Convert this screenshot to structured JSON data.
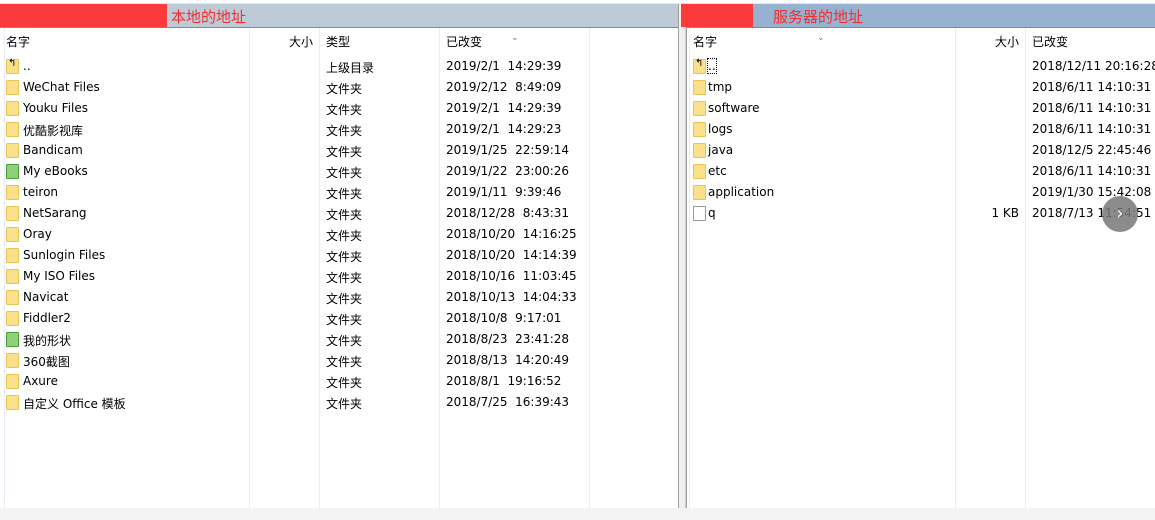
{
  "local": {
    "title": "本地的地址",
    "headers": {
      "name": "名字",
      "size": "大小",
      "type": "类型",
      "modified": "已改变"
    },
    "rows": [
      {
        "name": "..",
        "type": "上级目录",
        "modified": "2019/2/1  14:29:39",
        "icon": "parent-folder"
      },
      {
        "name": "WeChat Files",
        "type": "文件夹",
        "modified": "2019/2/12  8:49:09",
        "icon": "folder"
      },
      {
        "name": "Youku Files",
        "type": "文件夹",
        "modified": "2019/2/1  14:29:39",
        "icon": "folder"
      },
      {
        "name": "优酷影视库",
        "type": "文件夹",
        "modified": "2019/2/1  14:29:23",
        "icon": "folder"
      },
      {
        "name": "Bandicam",
        "type": "文件夹",
        "modified": "2019/1/25  22:59:14",
        "icon": "folder"
      },
      {
        "name": "My eBooks",
        "type": "文件夹",
        "modified": "2019/1/22  23:00:26",
        "icon": "special-folder"
      },
      {
        "name": "teiron",
        "type": "文件夹",
        "modified": "2019/1/11  9:39:46",
        "icon": "folder"
      },
      {
        "name": "NetSarang",
        "type": "文件夹",
        "modified": "2018/12/28  8:43:31",
        "icon": "folder"
      },
      {
        "name": "Oray",
        "type": "文件夹",
        "modified": "2018/10/20  14:16:25",
        "icon": "folder"
      },
      {
        "name": "Sunlogin Files",
        "type": "文件夹",
        "modified": "2018/10/20  14:14:39",
        "icon": "folder"
      },
      {
        "name": "My ISO Files",
        "type": "文件夹",
        "modified": "2018/10/16  11:03:45",
        "icon": "folder"
      },
      {
        "name": "Navicat",
        "type": "文件夹",
        "modified": "2018/10/13  14:04:33",
        "icon": "folder"
      },
      {
        "name": "Fiddler2",
        "type": "文件夹",
        "modified": "2018/10/8  9:17:01",
        "icon": "folder"
      },
      {
        "name": "我的形状",
        "type": "文件夹",
        "modified": "2018/8/23  23:41:28",
        "icon": "special-folder"
      },
      {
        "name": "360截图",
        "type": "文件夹",
        "modified": "2018/8/13  14:20:49",
        "icon": "folder"
      },
      {
        "name": "Axure",
        "type": "文件夹",
        "modified": "2018/8/1  19:16:52",
        "icon": "folder"
      },
      {
        "name": "自定义 Office 模板",
        "type": "文件夹",
        "modified": "2018/7/25  16:39:43",
        "icon": "folder"
      }
    ]
  },
  "remote": {
    "title": "服务器的地址",
    "headers": {
      "name": "名字",
      "size": "大小",
      "modified": "已改变"
    },
    "rows": [
      {
        "name": "..",
        "size": "",
        "modified": "2018/12/11 20:16:28",
        "icon": "parent-folder"
      },
      {
        "name": "tmp",
        "size": "",
        "modified": "2018/6/11 14:10:31",
        "icon": "folder"
      },
      {
        "name": "software",
        "size": "",
        "modified": "2018/6/11 14:10:31",
        "icon": "folder"
      },
      {
        "name": "logs",
        "size": "",
        "modified": "2018/6/11 14:10:31",
        "icon": "folder"
      },
      {
        "name": "java",
        "size": "",
        "modified": "2018/12/5 22:45:46",
        "icon": "folder"
      },
      {
        "name": "etc",
        "size": "",
        "modified": "2018/6/11 14:10:31",
        "icon": "folder"
      },
      {
        "name": "application",
        "size": "",
        "modified": "2019/1/30 15:42:08",
        "icon": "folder"
      },
      {
        "name": "q",
        "size": "1 KB",
        "modified": "2018/7/13 11:54:51",
        "icon": "file"
      }
    ]
  },
  "colors": {
    "title_text": "#f03030",
    "redaction": "#fb3b3b"
  }
}
